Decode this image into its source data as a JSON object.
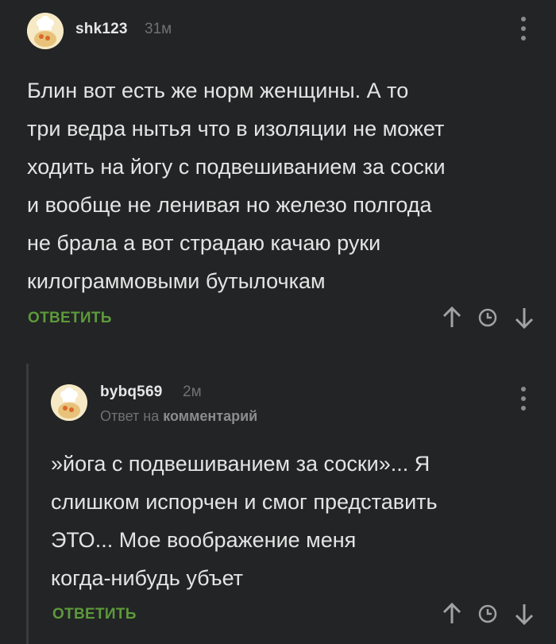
{
  "comments": [
    {
      "author": "shk123",
      "time": "31м",
      "text": "Блин вот есть же норм женщины. А то\nтри ведра нытья что в изоляции не может\nходить на йогу с подвешиванием за соски\nи вообще не ленивая но железо полгода\nне брала а вот страдаю качаю руки\nкилограммовыми бутылочкам",
      "reply_label": "ОТВЕТИТЬ"
    },
    {
      "author": "bybq569",
      "time": "2м",
      "reply_prefix": "Ответ на",
      "reply_target": "комментарий",
      "text": "»йога с подвешиванием за соски»... Я\nслишком испорчен и смог представить\nЭТО... Мое воображение меня\nкогда-нибудь убъет",
      "reply_label": "ОТВЕТИТЬ"
    }
  ],
  "colors": {
    "background": "#232425",
    "accent_green": "#5c9a3b",
    "muted": "#6f7173"
  },
  "icons": [
    "chef-avatar",
    "more-vertical-icon",
    "arrow-up-icon",
    "clock-icon",
    "arrow-down-icon"
  ]
}
